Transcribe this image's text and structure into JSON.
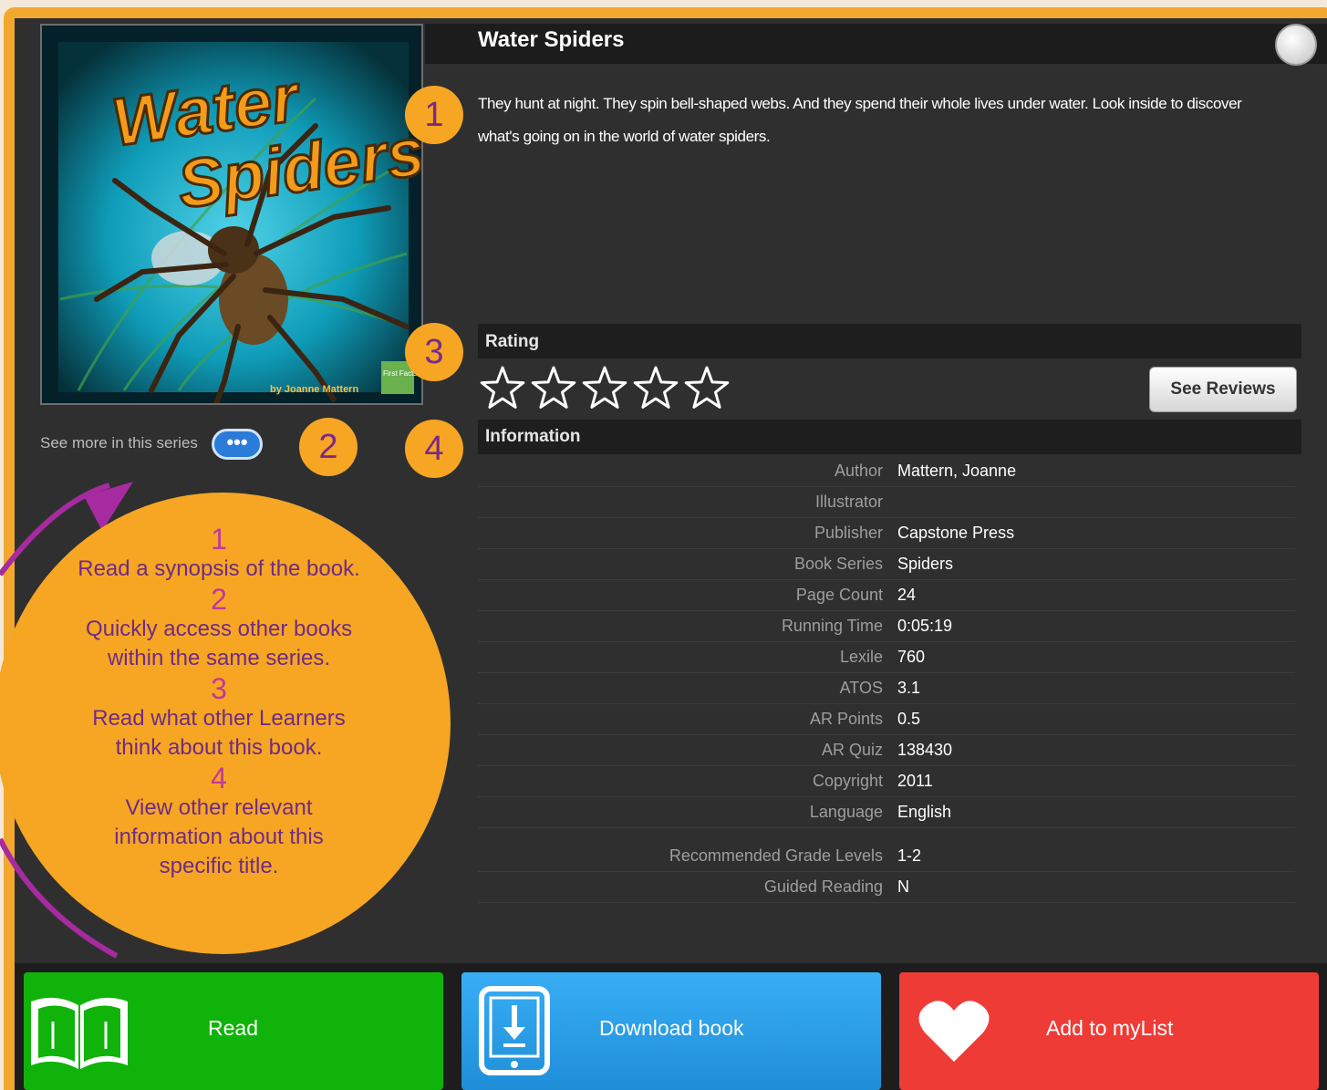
{
  "book": {
    "title": "Water Spiders",
    "synopsis": "They hunt at night. They spin bell-shaped webs. And they spend their whole lives under water. Look inside to discover what's going on in the world of water spiders.",
    "cover_title_line1": "Water",
    "cover_title_line2": "Spiders",
    "cover_byline": "by Joanne Mattern",
    "cover_logo": "First Facts"
  },
  "series": {
    "label": "See more in this series",
    "button_label": "•••"
  },
  "badges": [
    "1",
    "2",
    "3",
    "4"
  ],
  "rating": {
    "header": "Rating",
    "stars_max": 5,
    "stars_filled": 0,
    "see_reviews_label": "See Reviews"
  },
  "information": {
    "header": "Information",
    "rows": [
      {
        "label": "Author",
        "value": "Mattern, Joanne"
      },
      {
        "label": "Illustrator",
        "value": ""
      },
      {
        "label": "Publisher",
        "value": "Capstone Press"
      },
      {
        "label": "Book Series",
        "value": "Spiders"
      },
      {
        "label": "Page Count",
        "value": "24"
      },
      {
        "label": "Running Time",
        "value": "0:05:19"
      },
      {
        "label": "Lexile",
        "value": "760"
      },
      {
        "label": "ATOS",
        "value": "3.1"
      },
      {
        "label": "AR Points",
        "value": "0.5"
      },
      {
        "label": "AR Quiz",
        "value": "138430"
      },
      {
        "label": "Copyright",
        "value": "2011"
      },
      {
        "label": "Language",
        "value": "English"
      },
      {
        "label": "Recommended Grade Levels",
        "value": "1-2"
      },
      {
        "label": "Guided Reading",
        "value": "N"
      }
    ]
  },
  "callout": {
    "items": [
      {
        "num": "1",
        "lines": [
          "Read a synopsis of the book."
        ]
      },
      {
        "num": "2",
        "lines": [
          "Quickly access other books",
          "within the same series."
        ]
      },
      {
        "num": "3",
        "lines": [
          "Read what other Learners",
          "think about this book."
        ]
      },
      {
        "num": "4",
        "lines": [
          "View other relevant",
          "information about this",
          "specific title."
        ]
      }
    ]
  },
  "actions": {
    "read_label": "Read",
    "download_label": "Download book",
    "mylist_label": "Add to myList"
  },
  "colors": {
    "accent_orange": "#f6a623",
    "callout_purple": "#6e2b86",
    "read_green": "#10b30a",
    "download_blue": "#2b9be8",
    "mylist_red": "#ef3b36"
  }
}
